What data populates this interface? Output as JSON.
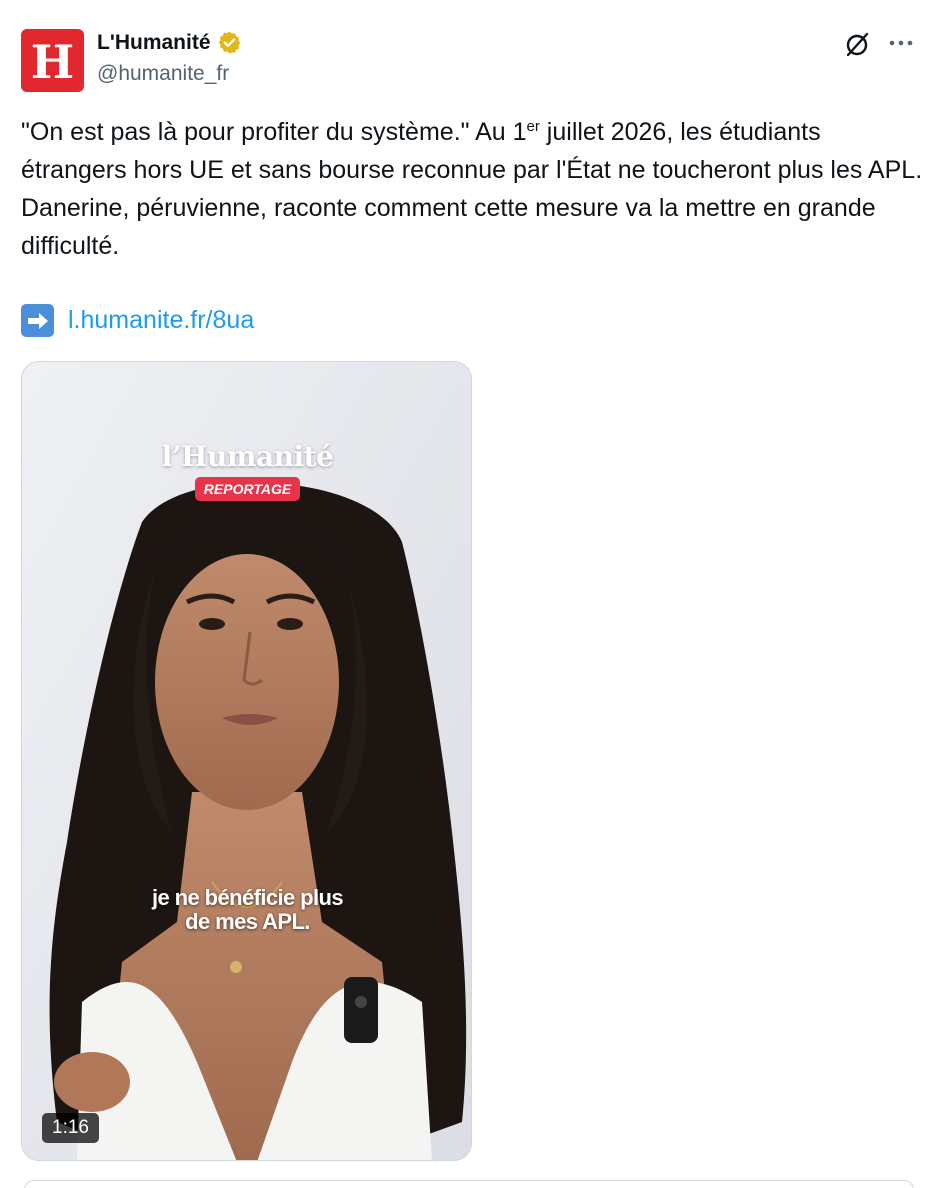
{
  "author": {
    "avatar_letter": "H",
    "display_name": "L'Humanité",
    "handle": "@humanite_fr",
    "brand_color": "#e0282e",
    "badge_color": "#e2b719"
  },
  "header_actions": {
    "grok_icon": "grok-icon",
    "more_icon": "more-icon"
  },
  "tweet": {
    "text_part1": "\"On est pas là pour profiter du système.\" Au 1",
    "text_sup": "er",
    "text_part2": " juillet 2026, les étudiants étrangers hors UE et sans bourse reconnue par l'État ne toucheront plus les APL. Danerine, péruvienne, raconte comment cette mesure va la mettre en grande difficulté.",
    "arrow_emoji": "right-arrow-emoji",
    "link_text": "l.humanite.fr/8ua",
    "link_color": "#1d9bf0"
  },
  "video": {
    "brand_overlay": "l’Humanité",
    "tag": "REPORTAGE",
    "tag_color": "#e6354a",
    "caption_line1": "je ne bénéficie plus",
    "caption_line2": "de mes APL.",
    "duration": "1:16"
  }
}
